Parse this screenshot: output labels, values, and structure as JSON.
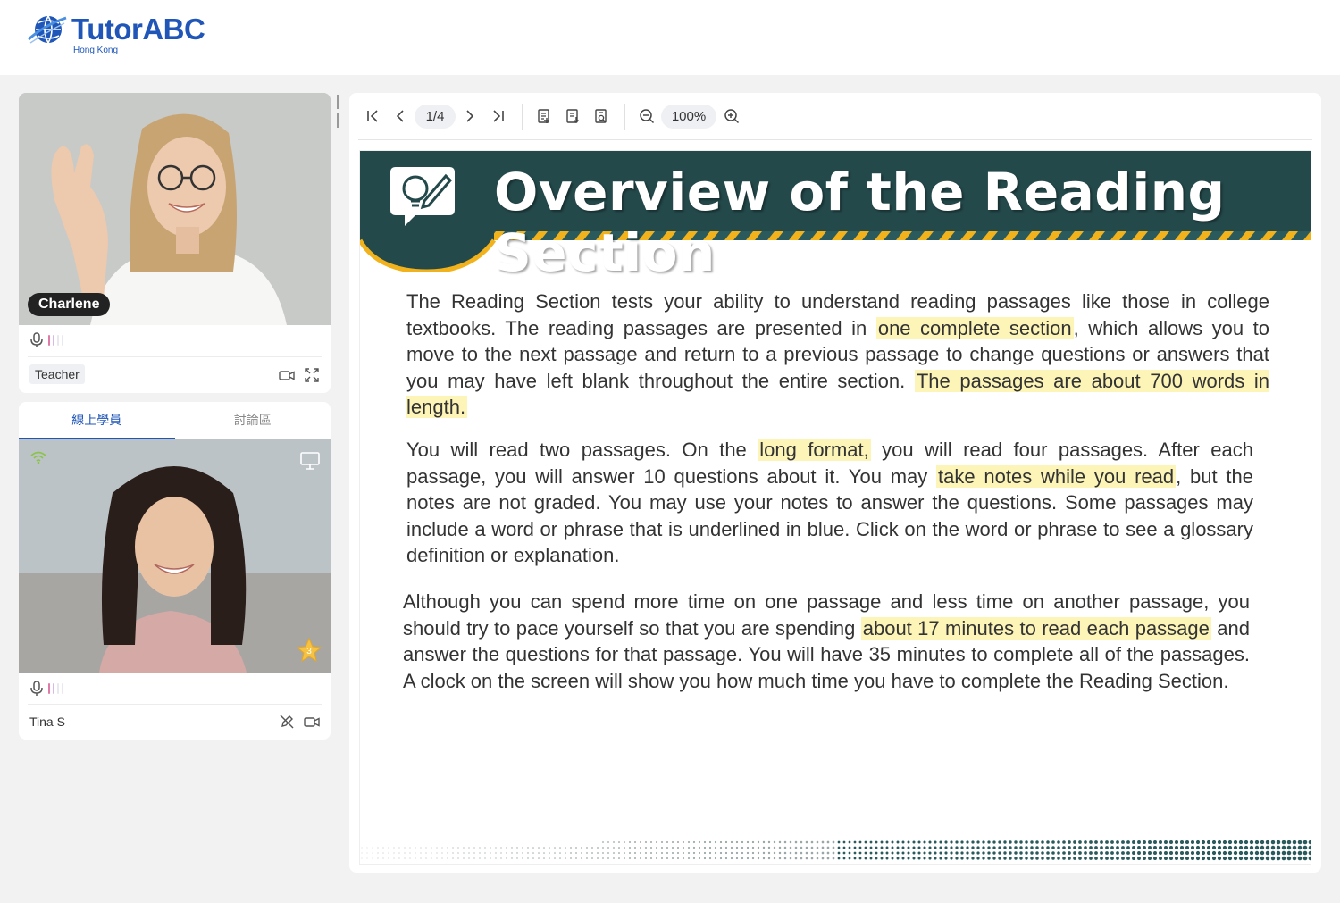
{
  "brand": {
    "name": "TutorABC",
    "region": "Hong Kong"
  },
  "teacher": {
    "name": "Charlene",
    "role": "Teacher"
  },
  "student_tabs": [
    {
      "label": "線上學員",
      "active": true
    },
    {
      "label": "討論區",
      "active": false
    }
  ],
  "student": {
    "name": "Tina S",
    "stars": "3"
  },
  "viewer": {
    "page": "1/4",
    "zoom": "100%"
  },
  "slide": {
    "title": "Overview of the Reading Section",
    "p1": [
      {
        "t": "The Reading Section tests your ability to understand reading passages like those in college textbooks. The reading passages are presented in "
      },
      {
        "t": "one complete section",
        "hl": true
      },
      {
        "t": ", which allows you to move to the next passage and return to a previous passage to change questions or answers that you may have left blank throughout the entire section. "
      },
      {
        "t": "The passages are about 700 words in length.",
        "hl": true
      }
    ],
    "p2": [
      {
        "t": "You will read two passages. On the "
      },
      {
        "t": "long format,",
        "hl": true
      },
      {
        "t": " you will read four passages. After each passage, you will answer 10 questions about it. You may "
      },
      {
        "t": "take notes while you read",
        "hl": true
      },
      {
        "t": ", but the notes are not graded. You may use your notes to answer the questions. Some passages may include a word or phrase that is underlined in blue. Click on the word or phrase to see a glossary definition or explanation."
      }
    ],
    "p3": [
      {
        "t": "Although you can spend more time on one passage and less time on another passage, you should try to pace yourself so that you are spending "
      },
      {
        "t": "about 17 minutes to read each passage",
        "hl": true
      },
      {
        "t": " and answer the questions for that passage. You will have 35 minutes to complete all of the passages. A clock on the screen will show you how much time you have to complete the Reading Section."
      }
    ]
  }
}
